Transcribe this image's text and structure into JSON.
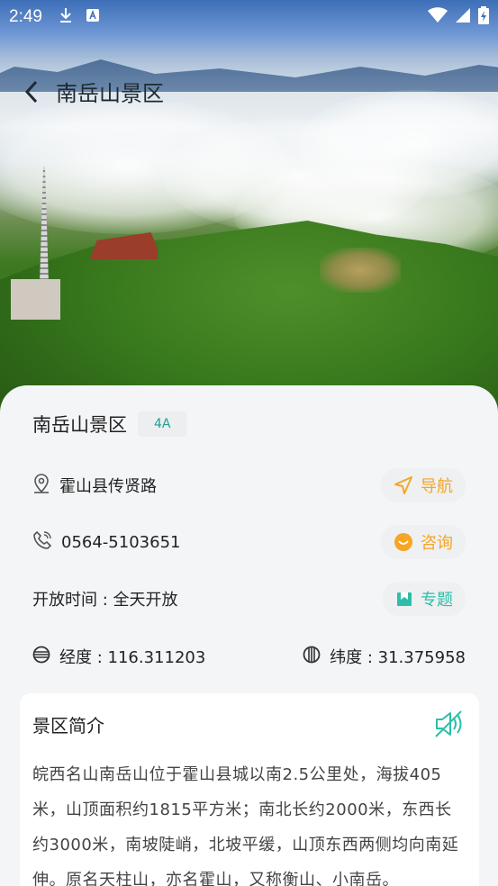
{
  "status_bar": {
    "time": "2:49",
    "icons": [
      "download-icon",
      "a-box-icon",
      "wifi-icon",
      "signal-icon",
      "battery-icon"
    ]
  },
  "header": {
    "title": "南岳山景区"
  },
  "spot": {
    "name": "南岳山景区",
    "grade": "4A",
    "address": "霍山县传贤路",
    "phone": "0564-5103651",
    "hours": "开放时间 : 全天开放",
    "longitude": "经度 : 116.311203",
    "latitude": "纬度 : 31.375958"
  },
  "actions": {
    "navigate": "导航",
    "consult": "咨询",
    "topic": "专题"
  },
  "intro": {
    "title": "景区简介",
    "body": "皖西名山南岳山位于霍山县城以南2.5公里处，海拔405米，山顶面积约1815平方米；南北长约2000米，东西长约3000米，南坡陡峭，北坡平缓，山顶东西两侧均向南延伸。原名天柱山，亦名霍山，又称衡山、小南岳。"
  },
  "colors": {
    "accent_orange": "#f5a623",
    "accent_teal": "#2bbfa8",
    "badge_text": "#1fa38f"
  }
}
